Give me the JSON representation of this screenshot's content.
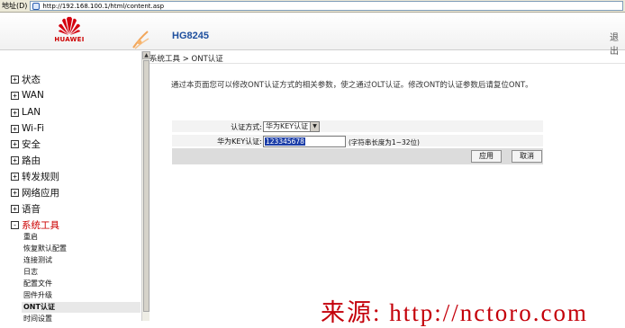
{
  "address_bar": {
    "label": "地址(D)",
    "url": "http://192.168.100.1/html/content.asp"
  },
  "header": {
    "brand": "HUAWEI",
    "model": "HG8245",
    "logout": "退出"
  },
  "sidebar": {
    "items": [
      {
        "label": "状态",
        "toggle": "+",
        "active": false
      },
      {
        "label": "WAN",
        "toggle": "+",
        "active": false
      },
      {
        "label": "LAN",
        "toggle": "+",
        "active": false
      },
      {
        "label": "Wi-Fi",
        "toggle": "+",
        "active": false
      },
      {
        "label": "安全",
        "toggle": "+",
        "active": false
      },
      {
        "label": "路由",
        "toggle": "+",
        "active": false
      },
      {
        "label": "转发规则",
        "toggle": "+",
        "active": false
      },
      {
        "label": "网络应用",
        "toggle": "+",
        "active": false
      },
      {
        "label": "语音",
        "toggle": "+",
        "active": false
      },
      {
        "label": "系统工具",
        "toggle": "-",
        "active": true
      }
    ],
    "subitems": [
      "重启",
      "恢复默认配置",
      "连接测试",
      "日志",
      "配置文件",
      "固件升级",
      "ONT认证",
      "时间设置"
    ],
    "active_subitem": "ONT认证"
  },
  "breadcrumb": "系统工具 > ONT认证",
  "intro": "通过本页面您可以修改ONT认证方式的相关参数，使之通过OLT认证。修改ONT的认证参数后请复位ONT。",
  "form": {
    "auth_mode_label": "认证方式:",
    "auth_mode_value": "华为KEY认证",
    "key_label": "华为KEY认证:",
    "key_value": "123345678",
    "key_hint": "(字符串长度为1~32位)",
    "apply_label": "应用",
    "cancel_label": "取消"
  },
  "watermark": "来源: http://nctoro.com"
}
